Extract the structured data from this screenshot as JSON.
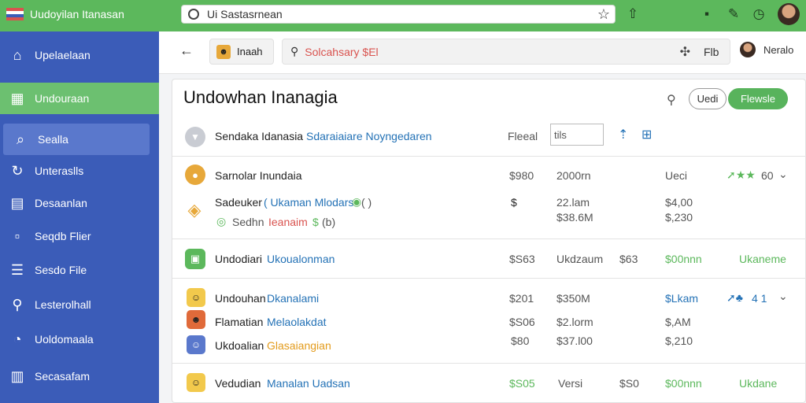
{
  "app": {
    "title": "Uudoyilan Itanasan"
  },
  "url": {
    "value": "Ui Sastasrnean"
  },
  "sidebar": {
    "items": [
      {
        "label": "Upelaelaan",
        "icon": "home-icon"
      },
      {
        "label": "Undouraan",
        "icon": "grid-icon"
      },
      {
        "label": "Sealla",
        "icon": "search-icon"
      },
      {
        "label": "Unteraslls",
        "icon": "refresh-icon"
      },
      {
        "label": "Desaanlan",
        "icon": "table-icon"
      },
      {
        "label": "Seqdb Flier",
        "icon": "file-icon"
      },
      {
        "label": "Sesdo File",
        "icon": "list-icon"
      },
      {
        "label": "Lesterolhall",
        "icon": "search-icon"
      },
      {
        "label": "Uoldomaala",
        "icon": "clock-icon"
      },
      {
        "label": "Secasafam",
        "icon": "file-lines-icon"
      }
    ]
  },
  "toolbar": {
    "chip_label": "Inaah",
    "search_value": "Solcahsary $El",
    "right_label": "Flb",
    "user_name": "Neralo"
  },
  "panel": {
    "title": "Undowhan Inanagia",
    "btn_outline": "Uedi",
    "btn_green": "Flewsle"
  },
  "filter": {
    "a": "Sendaka Idanasia",
    "b": "Sdaraiaiare Noyngedaren",
    "c": "Fleeal",
    "input": "tils"
  },
  "rows": {
    "r1": {
      "name": "Sarnolar Inundaia",
      "col1": "$980",
      "col2": "2000rn",
      "col3": "Ueci",
      "sub_a": "Sadeuker",
      "sub_b": "( Ukaman Mlodars",
      "sub_c": "(  )",
      "sub2_a": "Sedhn",
      "sub2_b": "Ieanaim",
      "sub2_c": "$",
      "sub2_d": "(b)",
      "mark": "$",
      "val1": "22.lam",
      "val2": "$38.6M",
      "val3": "$4,00",
      "val4": "$,230",
      "rating": "60"
    },
    "r2": {
      "name": "Undodiari",
      "link": "Ukoualonman",
      "c1": "$S63",
      "c2": "Ukdzaum",
      "c3": "$63",
      "c4": "$00nnn",
      "c5": "Ukaneme"
    },
    "r3": {
      "l1": "Undouhan",
      "l1b": "Dkanalami",
      "l2": "Flamatian",
      "l2b": "Melaolakdat",
      "l3": "Ukdoalian",
      "l3b": "Glasaiangian",
      "c1a": "$201",
      "c1b": "$S06",
      "c1c": "$80",
      "c2a": "$350M",
      "c2b": "$2.lorm",
      "c2c": "$37.l00",
      "c3a": "$Lkam",
      "c3b": "$,AM",
      "c3c": "$,210",
      "rating": "4 1"
    },
    "r4": {
      "name": "Vedudian",
      "link": "Manalan Uadsan",
      "c1": "$S05",
      "c2": "Versi",
      "c3": "$S0",
      "c4": "$00nnn",
      "c5": "Ukdane"
    }
  },
  "colors": {
    "accent_green": "#5cb85c",
    "sidebar_blue": "#3b5cb8",
    "link_blue": "#2472b6"
  }
}
